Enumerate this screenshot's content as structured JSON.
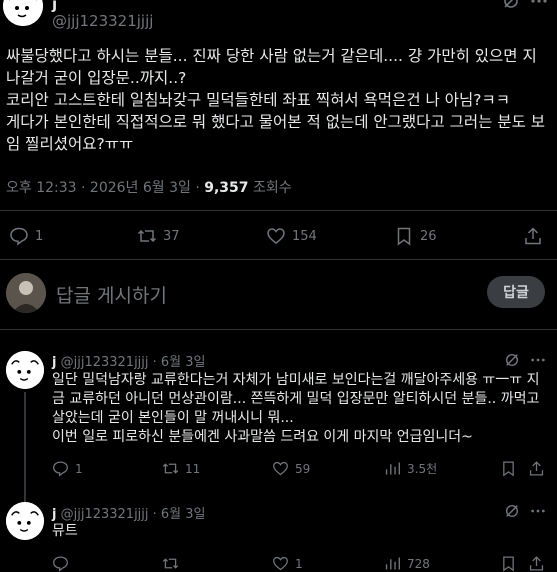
{
  "main_tweet": {
    "display_name": "j",
    "handle": "@jjj123321jjjj",
    "text": "싸불당했다고 하시는 분들... 진짜 당한 사람 없는거 같은데.... 걍 가만히 있으면 지나갈거 굳이 입장문..까지..?\n코리안 고스트한테 일침놔갖구 밀덕들한테 좌표 찍혀서 욕먹은건 나 아님?ㅋㅋ\n게다가 본인한테 직접적으로 뭐 했다고 물어본 적 없는데 안그랬다고 그러는 분도 보임 찔리셨어요?ㅠㅠ",
    "timestamp": "오후 12:33 · 2026년 6월 3일 · ",
    "views": "9,357",
    "views_label": " 조회수",
    "stats": {
      "replies": "1",
      "retweets": "37",
      "likes": "154",
      "bookmarks": "26"
    }
  },
  "reply_box": {
    "placeholder": "답글 게시하기",
    "button_label": "답글"
  },
  "replies": [
    {
      "display_name": "j",
      "handle_date": "@jjj123321jjjj · 6월 3일",
      "text": "일단 밀덕남자랑 교류한다는거 자체가 남미새로 보인다는걸 깨달아주세용 ㅠ一ㅠ 지금 교류하던 아니던 먼상관이람... 쯘뜩하게 밀덕 입장문만 알티하시던 분들.. 까먹고 살았는데 굳이 본인들이 말 꺼내시니 뭐...\n이번 일로 피로하신 분들에겐 사과말씀 드려요 이게 마지막 언급임니더~",
      "stats": {
        "replies": "1",
        "retweets": "11",
        "likes": "59",
        "views": "3.5천"
      }
    },
    {
      "display_name": "j",
      "handle_date": "@jjj123321jjjj · 6월 3일",
      "text": "뮤트",
      "stats": {
        "replies": "",
        "retweets": "",
        "likes": "1",
        "views": "728"
      }
    }
  ],
  "icons": [
    "more-icon",
    "grok-icon",
    "reply-icon",
    "retweet-icon",
    "like-icon",
    "bookmark-icon",
    "share-icon",
    "views-icon"
  ]
}
